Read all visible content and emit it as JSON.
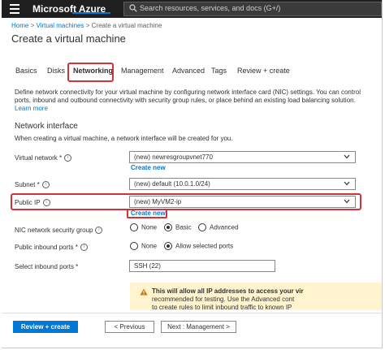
{
  "header": {
    "brand": "Microsoft Azure",
    "search_placeholder": "Search resources, services, and docs (G+/)"
  },
  "breadcrumb": {
    "home": "Home",
    "sep1": ">",
    "vms": "Virtual machines",
    "sep2": ">",
    "current": "Create a virtual machine"
  },
  "page_title": "Create a virtual machine",
  "tabs": [
    {
      "label": "Basics"
    },
    {
      "label": "Disks"
    },
    {
      "label": "Networking",
      "active": true
    },
    {
      "label": "Management"
    },
    {
      "label": "Advanced"
    },
    {
      "label": "Tags"
    },
    {
      "label": "Review + create"
    }
  ],
  "description": {
    "line1": "Define network connectivity for your virtual machine by configuring network interface card (NIC) settings. You can control",
    "line2": "ports, inbound and outbound connectivity with security group rules, or place behind an existing load balancing solution.",
    "learn_more": "Learn more"
  },
  "network_interface": {
    "title": "Network interface",
    "subtext": "When creating a virtual machine, a network interface will be created for you.",
    "virtual_network": {
      "label": "Virtual network *",
      "value": "(new) newresgroupvnet770",
      "create_new": "Create new"
    },
    "subnet": {
      "label": "Subnet *",
      "value": "(new) default (10.0.1.0/24)"
    },
    "public_ip": {
      "label": "Public IP",
      "value": "(new) MyVM2-ip",
      "create_new": "Create new"
    },
    "nic_nsg": {
      "label": "NIC network security group",
      "options": [
        "None",
        "Basic",
        "Advanced"
      ],
      "selected": "Basic"
    },
    "public_inbound_ports": {
      "label": "Public inbound ports *",
      "options": [
        "None",
        "Allow selected ports"
      ],
      "selected": "Allow selected ports"
    },
    "select_inbound_ports": {
      "label": "Select inbound ports *",
      "value": "SSH (22)"
    }
  },
  "warning": {
    "line1": "This will allow all IP addresses to access your vir",
    "line2": "recommended for testing.  Use the Advanced cont",
    "line3": "to create rules to limit inbound traffic to known IP"
  },
  "footer": {
    "review_create": "Review + create",
    "previous": "< Previous",
    "next": "Next : Management >"
  },
  "colors": {
    "accent": "#0078d4",
    "highlight": "#d13438",
    "topbar": "#1f1f1f",
    "warning_bg": "#fff4ce"
  }
}
